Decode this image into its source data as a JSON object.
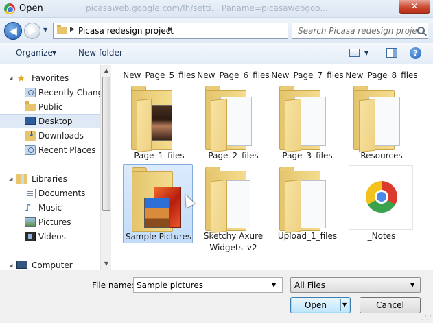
{
  "window": {
    "title": "Open",
    "close_label": "✕",
    "background_url": "picasaweb.google.com/lh/setti... Paname=picasawebgoo..."
  },
  "navigation": {
    "back_glyph": "◀",
    "forward_glyph": "▶",
    "address_path": "Picasa redesign project",
    "search_placeholder": "Search Picasa redesign project"
  },
  "toolbar": {
    "organize_label": "Organize",
    "new_folder_label": "New folder",
    "help_label": "?"
  },
  "sidebar": {
    "favorites": {
      "label": "Favorites",
      "items": [
        {
          "label": "Recently Change",
          "icon": "recent-places-icon"
        },
        {
          "label": "Public",
          "icon": "folder-icon"
        },
        {
          "label": "Desktop",
          "icon": "desktop-icon",
          "selected": true
        },
        {
          "label": "Downloads",
          "icon": "downloads-icon"
        },
        {
          "label": "Recent Places",
          "icon": "recent-places-icon"
        }
      ]
    },
    "libraries": {
      "label": "Libraries",
      "items": [
        {
          "label": "Documents",
          "icon": "documents-icon"
        },
        {
          "label": "Music",
          "icon": "music-icon"
        },
        {
          "label": "Pictures",
          "icon": "pictures-icon"
        },
        {
          "label": "Videos",
          "icon": "videos-icon"
        }
      ]
    },
    "computer": {
      "label": "Computer"
    }
  },
  "files": {
    "row0": [
      "New_Page_5_files",
      "New_Page_6_files",
      "New_Page_7_files",
      "New_Page_8_files"
    ],
    "row1": [
      "Page_1_files",
      "Page_2_files",
      "Page_3_files",
      "Resources"
    ],
    "row2": [
      "Sample Pictures",
      "Sketchy Axure Widgets_v2",
      "Upload_1_files",
      "_Notes"
    ],
    "selected": "Sample Pictures"
  },
  "bottom": {
    "file_name_label": "File name:",
    "file_name_value": "Sample pictures",
    "filter_value": "All Files",
    "open_label": "Open",
    "cancel_label": "Cancel"
  },
  "colors": {
    "accent": "#1f5fb8",
    "selection": "#c2dcf9",
    "folder": "#e8c56a"
  }
}
